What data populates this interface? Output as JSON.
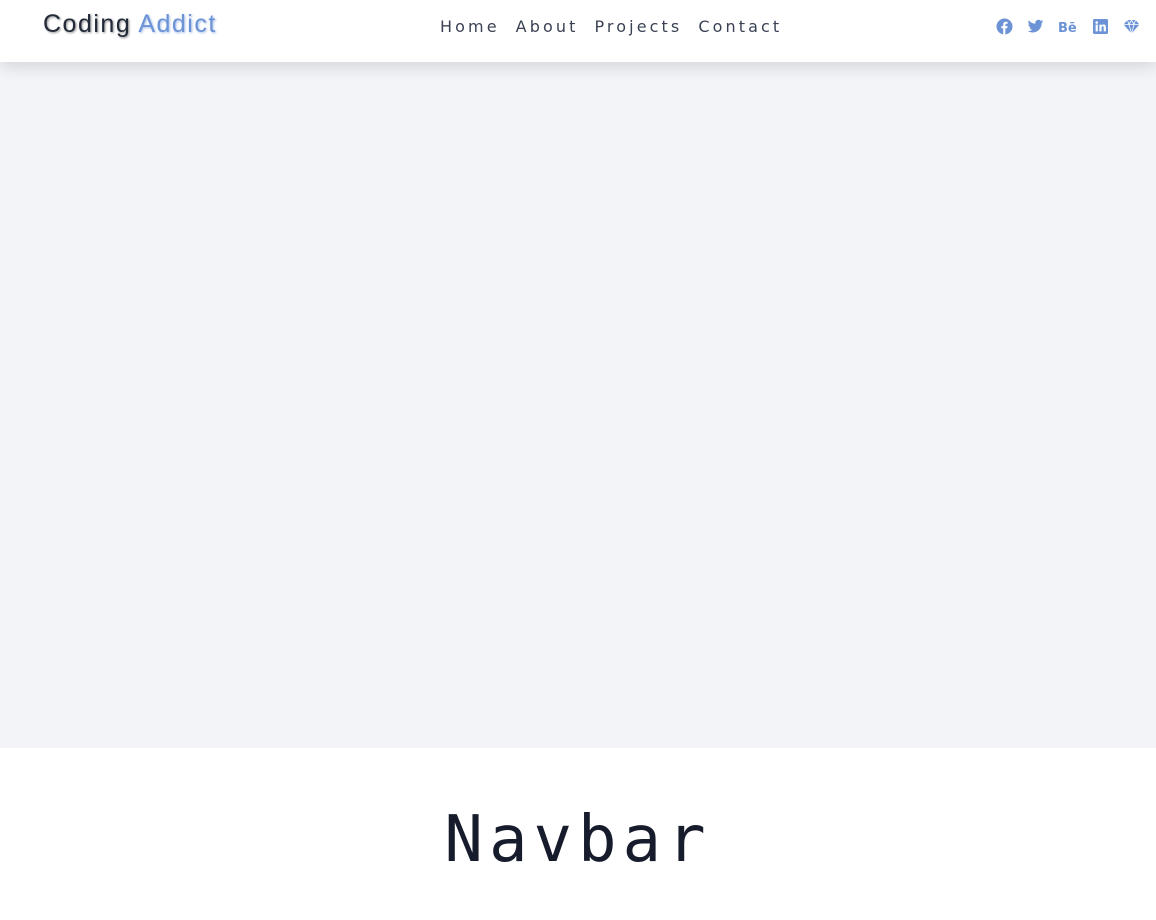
{
  "brand": {
    "word1": "Coding",
    "word2": "Addict",
    "accent_color": "#6b93d6"
  },
  "nav": {
    "links": [
      {
        "label": "Home"
      },
      {
        "label": "About"
      },
      {
        "label": "Projects"
      },
      {
        "label": "Contact"
      }
    ]
  },
  "social": {
    "icon_color": "#6b93d6",
    "icons": [
      "facebook-icon",
      "twitter-icon",
      "behance-icon",
      "linkedin-icon",
      "sketch-icon"
    ]
  },
  "hero": {
    "background": "#f2f4f8"
  },
  "page_title": "Navbar"
}
